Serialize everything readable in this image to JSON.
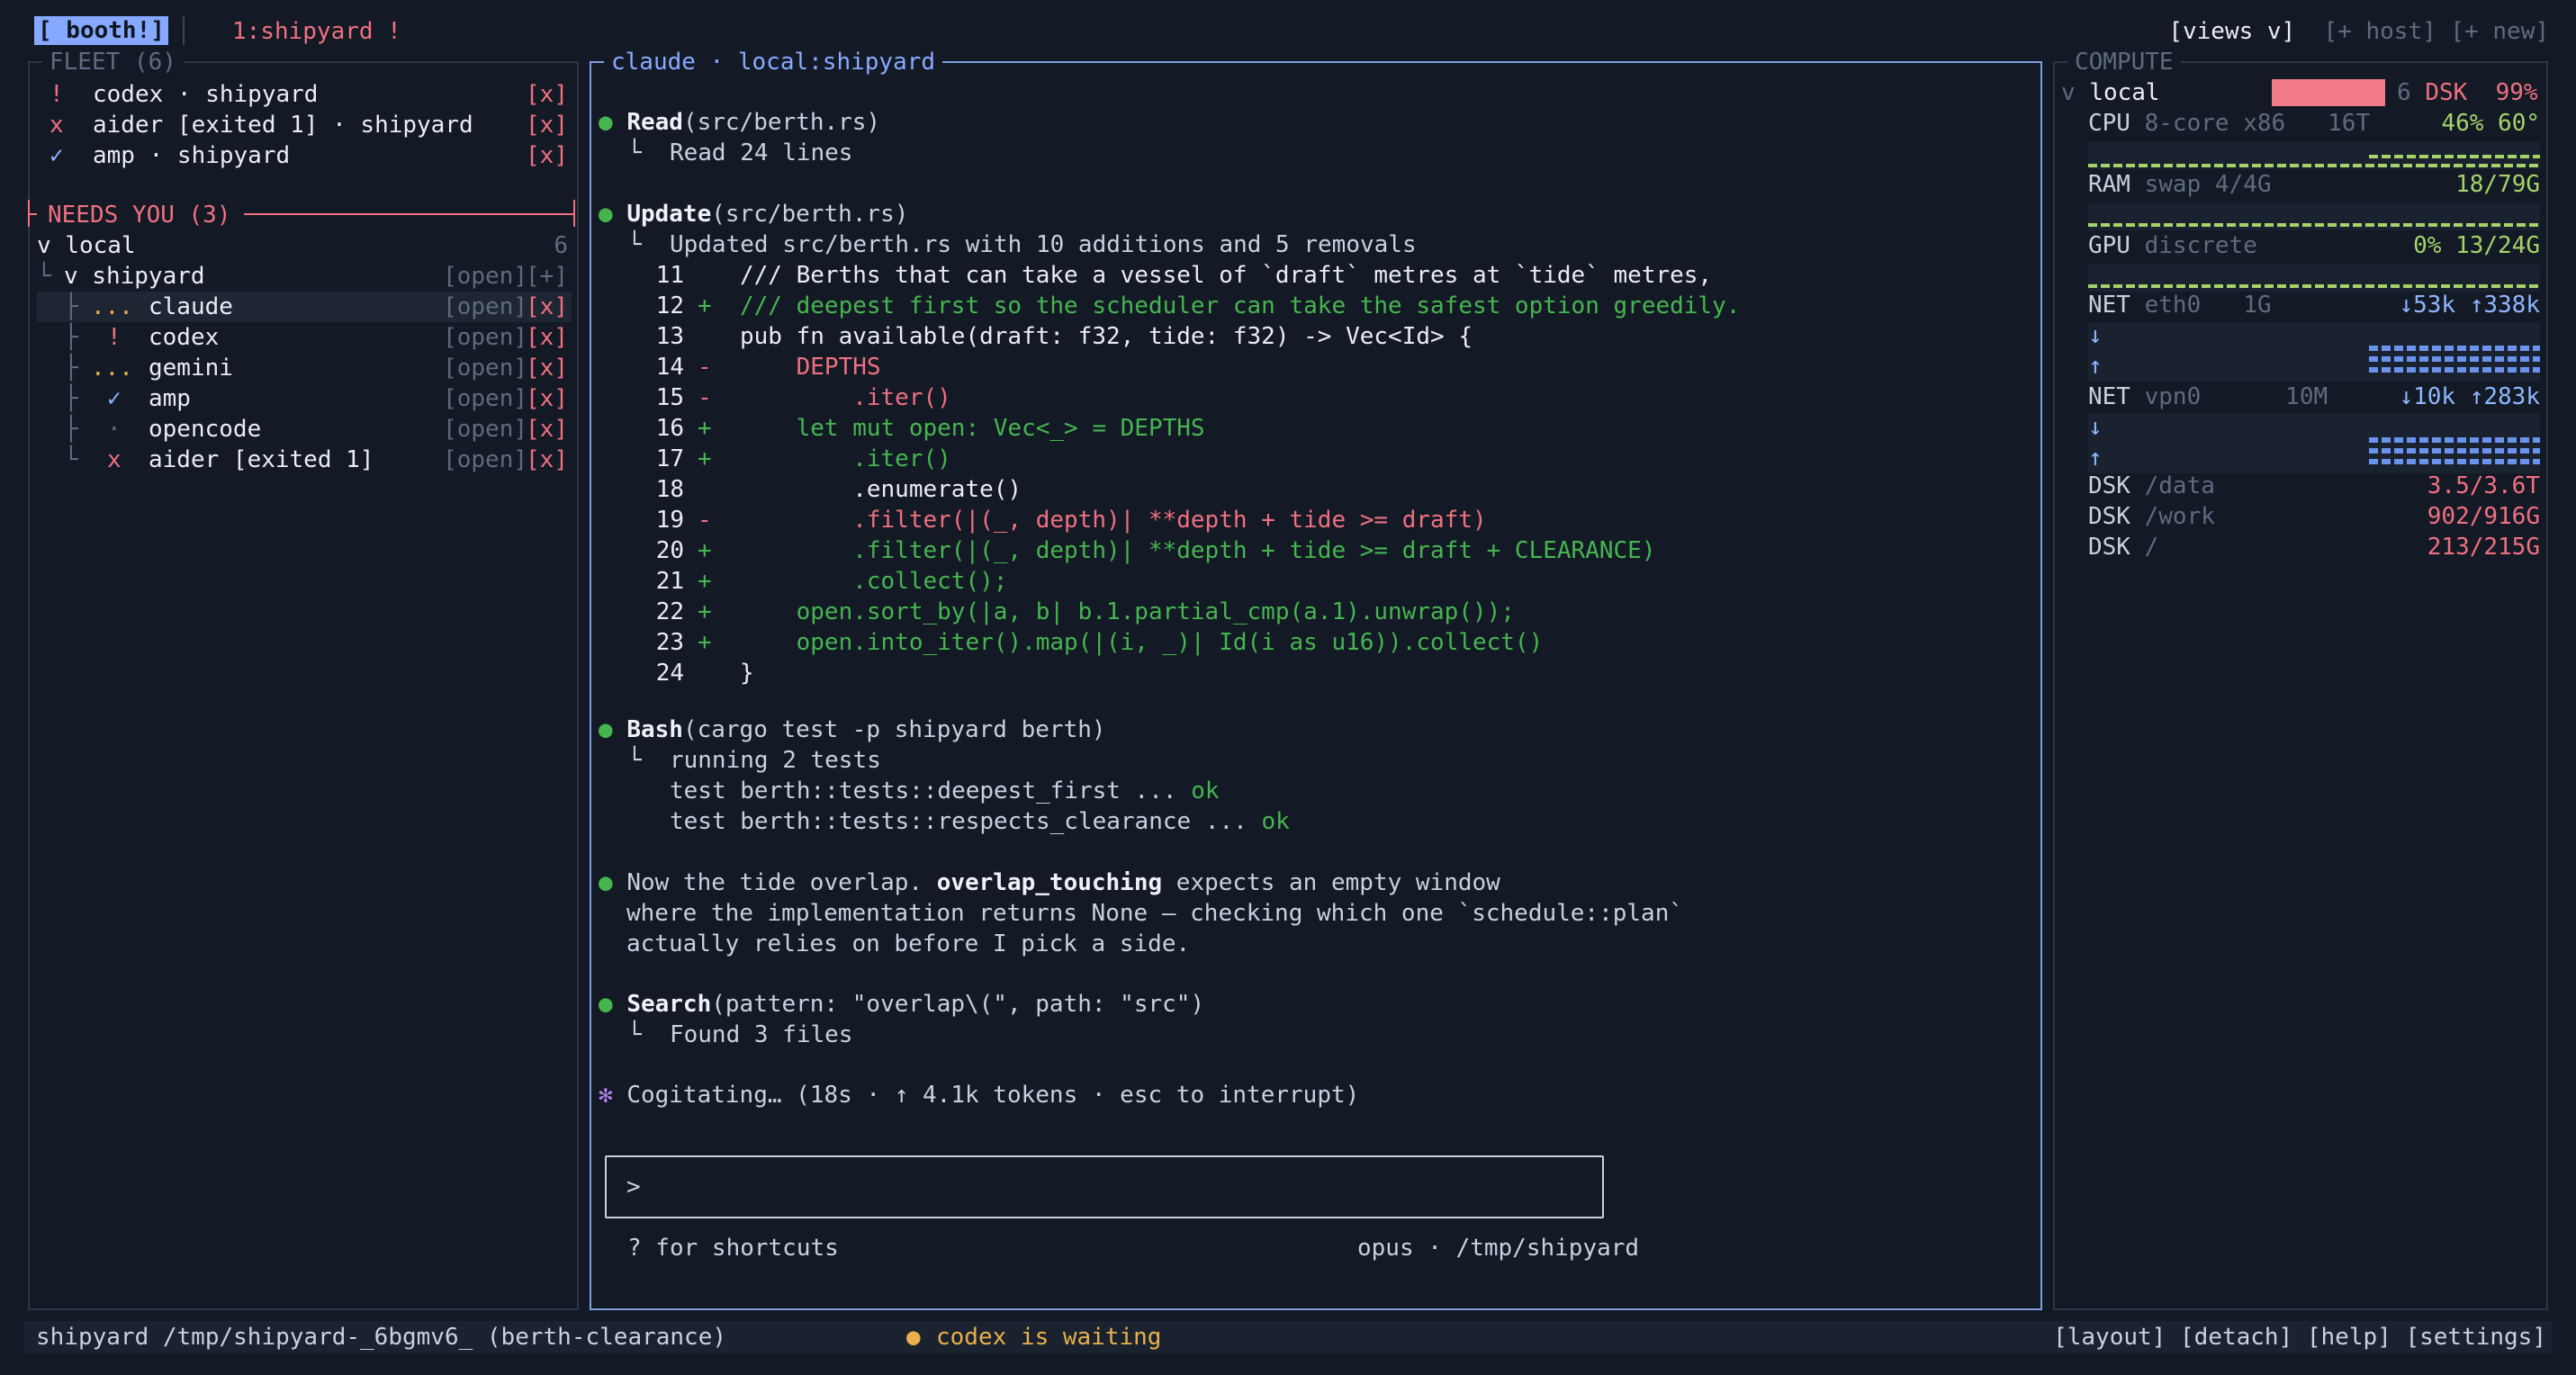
{
  "topbar": {
    "logo": "[ booth!]",
    "workspace": "1:shipyard !",
    "views": "[views v]",
    "host": "[+ host]",
    "new": "[+ new]"
  },
  "fleet": {
    "title": "FLEET (6)",
    "agents": [
      {
        "mark": "!",
        "label": "codex · shipyard",
        "close": "[x]"
      },
      {
        "mark": "x",
        "label": "aider [exited 1] · shipyard",
        "close": "[x]"
      },
      {
        "mark": "✓",
        "label": "amp · shipyard",
        "close": "[x]"
      }
    ],
    "needs_you": "NEEDS YOU (3)",
    "tree": {
      "host": "v local",
      "host_count": "6",
      "project": "v shipyard",
      "project_open": "[open]",
      "project_add": "[+]",
      "items": [
        {
          "mark": "...",
          "label": "claude",
          "open": "[open]",
          "close": "[x]"
        },
        {
          "mark": "!",
          "label": "codex",
          "open": "[open]",
          "close": "[x]"
        },
        {
          "mark": "...",
          "label": "gemini",
          "open": "[open]",
          "close": "[x]"
        },
        {
          "mark": "✓",
          "label": "amp",
          "open": "[open]",
          "close": "[x]"
        },
        {
          "mark": "·",
          "label": "opencode",
          "open": "[open]",
          "close": "[x]"
        },
        {
          "mark": "x",
          "label": "aider [exited 1]",
          "open": "[open]",
          "close": "[x]"
        }
      ]
    }
  },
  "session": {
    "title": "claude · local:shipyard",
    "read": {
      "name": "Read",
      "args": "(src/berth.rs)",
      "result": "Read 24 lines"
    },
    "update": {
      "name": "Update",
      "args": "(src/berth.rs)",
      "result": "Updated src/berth.rs with 10 additions and 5 removals"
    },
    "diff": [
      {
        "num": "11",
        "sign": "",
        "code": "/// Berths that can take a vessel of `draft` metres at `tide` metres,",
        "type": "ctx"
      },
      {
        "num": "12",
        "sign": "+",
        "code": "/// deepest first so the scheduler can take the safest option greedily.",
        "type": "add"
      },
      {
        "num": "13",
        "sign": "",
        "code": "pub fn available(draft: f32, tide: f32) -> Vec<Id> {",
        "type": "ctx"
      },
      {
        "num": "14",
        "sign": "-",
        "code": "    DEPTHS",
        "type": "del"
      },
      {
        "num": "15",
        "sign": "-",
        "code": "        .iter()",
        "type": "del"
      },
      {
        "num": "16",
        "sign": "+",
        "code": "    let mut open: Vec<_> = DEPTHS",
        "type": "add"
      },
      {
        "num": "17",
        "sign": "+",
        "code": "        .iter()",
        "type": "add"
      },
      {
        "num": "18",
        "sign": "",
        "code": "        .enumerate()",
        "type": "ctx"
      },
      {
        "num": "19",
        "sign": "-",
        "code": "        .filter(|(_, depth)| **depth + tide >= draft)",
        "type": "del"
      },
      {
        "num": "20",
        "sign": "+",
        "code": "        .filter(|(_, depth)| **depth + tide >= draft + CLEARANCE)",
        "type": "add"
      },
      {
        "num": "21",
        "sign": "+",
        "code": "        .collect();",
        "type": "add"
      },
      {
        "num": "22",
        "sign": "+",
        "code": "    open.sort_by(|a, b| b.1.partial_cmp(a.1).unwrap());",
        "type": "add"
      },
      {
        "num": "23",
        "sign": "+",
        "code": "    open.into_iter().map(|(i, _)| Id(i as u16)).collect()",
        "type": "add"
      },
      {
        "num": "24",
        "sign": "",
        "code": "}",
        "type": "ctx"
      }
    ],
    "bash": {
      "name": "Bash",
      "args": "(cargo test -p shipyard berth)",
      "result": "running 2 tests",
      "tests": [
        {
          "text": "test berth::tests::deepest_first ... ",
          "status": "ok"
        },
        {
          "text": "test berth::tests::respects_clearance ... ",
          "status": "ok"
        }
      ]
    },
    "message": {
      "pre": "Now the tide overlap. ",
      "bold": "overlap_touching",
      "post": " expects an empty window",
      "line2": "where the implementation returns None — checking which one `schedule::plan`",
      "line3": "actually relies on before I pick a side."
    },
    "search": {
      "name": "Search",
      "args": "(pattern: \"overlap\\(\", path: \"src\")",
      "result": "Found 3 files"
    },
    "thinking": "Cogitating… (18s · ↑ 4.1k tokens · esc to interrupt)",
    "prompt": ">",
    "shortcuts": "? for shortcuts",
    "model": "opus · /tmp/shipyard"
  },
  "compute": {
    "title": "COMPUTE",
    "host": "v local",
    "host_badge": "6",
    "host_dsk": "DSK  99%",
    "cpu": {
      "label": "CPU",
      "desc": "8-core x86",
      "threads": "16T",
      "value": "46% 60°",
      "usage": 0.46
    },
    "ram": {
      "label": "RAM",
      "desc": "swap 4/4G",
      "value": "18/79G",
      "usage": 0.23
    },
    "gpu": {
      "label": "GPU",
      "desc": "discrete",
      "value": "0% 13/24G",
      "usage": 0.0
    },
    "net": [
      {
        "label": "NET",
        "iface": "eth0",
        "speed": "1G",
        "value": "↓53k ↑338k",
        "down": "↓",
        "up": "↑"
      },
      {
        "label": "NET",
        "iface": "vpn0",
        "speed": "10M",
        "value": "↓10k ↑283k",
        "down": "↓",
        "up": "↑"
      }
    ],
    "disks": [
      {
        "label": "DSK",
        "path": "/data",
        "value": "3.5/3.6T"
      },
      {
        "label": "DSK",
        "path": "/work",
        "value": "902/916G"
      },
      {
        "label": "DSK",
        "path": "/",
        "value": "213/215G"
      }
    ]
  },
  "status": {
    "left": "shipyard /tmp/shipyard-_6bgmv6_ (berth-clearance)",
    "dot": "●",
    "notice": "codex is waiting",
    "layout": "[layout]",
    "detach": "[detach]",
    "help": "[help]",
    "settings": "[settings]"
  },
  "colors": {
    "background": "#131a26",
    "accent": "#86a8ff",
    "add": "#46b54f",
    "remove": "#f0707f",
    "warning": "#e8b04a"
  }
}
